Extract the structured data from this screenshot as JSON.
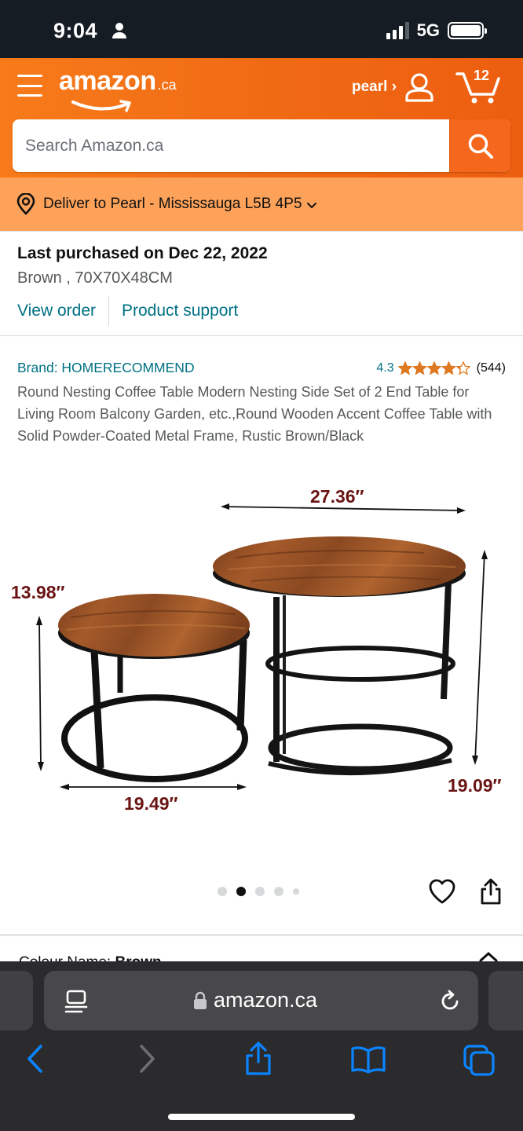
{
  "status_bar": {
    "time": "9:04",
    "network": "5G",
    "icons": [
      "person-icon",
      "signal-icon",
      "battery-icon"
    ]
  },
  "header": {
    "logo_word": "amazon",
    "logo_tld": ".ca",
    "account_label": "pearl ›",
    "cart_count": "12",
    "search_placeholder": "Search Amazon.ca"
  },
  "delivery": {
    "text": "Deliver to Pearl - Mississauga L5B 4P5"
  },
  "purchase": {
    "title": "Last purchased on Dec 22, 2022",
    "variant": "Brown , 70X70X48CM",
    "view_order": "View order",
    "product_support": "Product support"
  },
  "product": {
    "brand": "Brand: HOMERECOMMEND",
    "rating": "4.3",
    "rating_value": 4.3,
    "review_count": "(544)",
    "title": "Round Nesting Coffee Table Modern Nesting Side Set of 2 End Table for Living Room Balcony Garden, etc.,Round Wooden Accent Coffee Table with Solid Powder-Coated Metal Frame, Rustic Brown/Black",
    "image": {
      "dims": {
        "large_width": "27.36″",
        "small_height": "13.98″",
        "small_width": "19.49″",
        "large_height": "19.09″"
      }
    },
    "carousel": {
      "total": 5,
      "active_index": 1
    }
  },
  "next_section": {
    "label": "Colour Name:",
    "value": "Brown"
  },
  "safari": {
    "url": "amazon.ca"
  },
  "colors": {
    "header_orange": "#f06914",
    "deliver_bar": "#fea25a",
    "link_teal": "#007185",
    "star": "#de7921",
    "dimension_text": "#6a1414",
    "safari_bg": "#2b2b2d",
    "safari_blue": "#0a84ff"
  }
}
